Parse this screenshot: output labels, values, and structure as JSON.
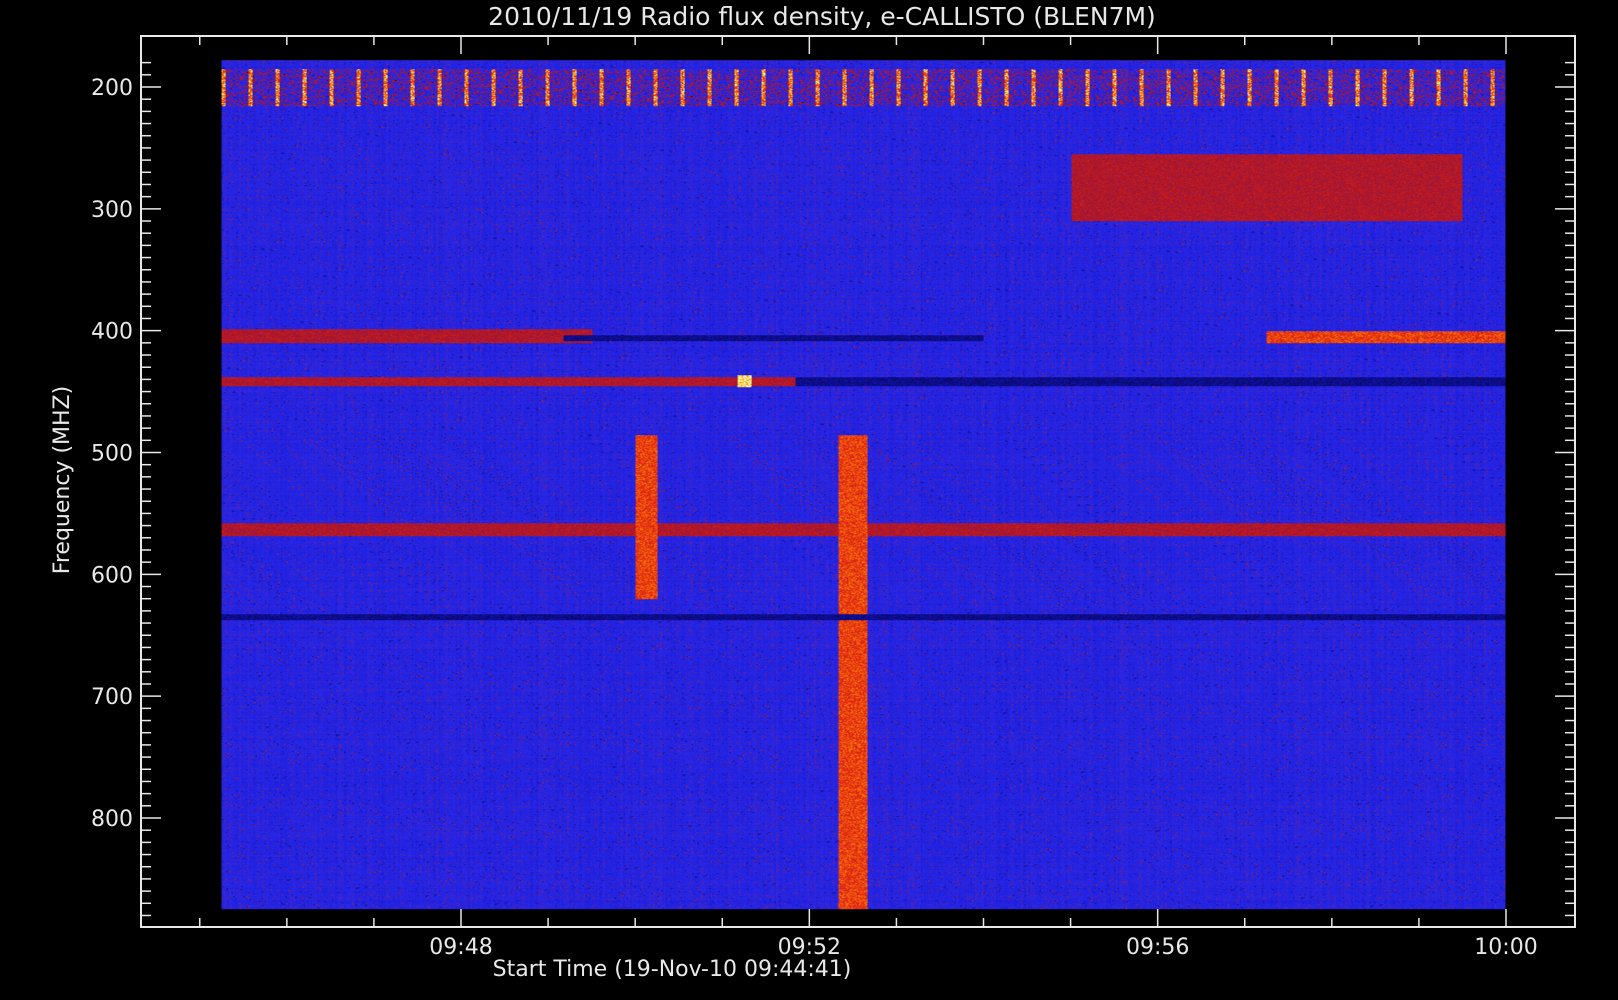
{
  "chart_data": {
    "type": "heatmap",
    "title": "2010/11/19  Radio flux density, e-CALLISTO (BLEN7M)",
    "xlabel": "Start Time (19-Nov-10 09:44:41)",
    "ylabel": "Frequency (MHZ)",
    "x_ticks": [
      "09:48",
      "09:52",
      "09:56",
      "10:00"
    ],
    "y_ticks": [
      "200",
      "300",
      "400",
      "500",
      "600",
      "700",
      "800"
    ],
    "x_range": [
      "09:44:41",
      "10:00:00"
    ],
    "y_range_mhz": [
      180,
      880
    ],
    "y_inverted": true,
    "colormap": [
      "#000000",
      "#1a1ae0",
      "#c0181a",
      "#ff6a00",
      "#ffff66",
      "#ffffff"
    ],
    "background_color": "#000000",
    "data_start_time": "09:45:15",
    "data_end_time": "10:00:00",
    "data_freq_mhz": [
      178,
      875
    ],
    "features": [
      {
        "name": "periodic interference bursts",
        "freq_mhz": [
          185,
          215
        ],
        "time": [
          "09:45:15",
          "10:00:00"
        ],
        "intensity": "high",
        "pattern": "dashed"
      },
      {
        "name": "emission band",
        "freq_mhz": [
          398,
          410
        ],
        "time": [
          "09:45:15",
          "09:49:30"
        ],
        "intensity": "medium"
      },
      {
        "name": "absorption line",
        "freq_mhz": [
          403,
          408
        ],
        "time": [
          "09:49:10",
          "09:54:00"
        ],
        "intensity": "low"
      },
      {
        "name": "strong emission band",
        "freq_mhz": [
          400,
          410
        ],
        "time": [
          "09:57:15",
          "10:00:00"
        ],
        "intensity": "high"
      },
      {
        "name": "emission line",
        "freq_mhz": [
          438,
          445
        ],
        "time": [
          "09:45:15",
          "09:51:50"
        ],
        "intensity": "medium"
      },
      {
        "name": "absorption line",
        "freq_mhz": [
          438,
          445
        ],
        "time": [
          "09:51:50",
          "10:00:00"
        ],
        "intensity": "low"
      },
      {
        "name": "bright spot",
        "freq_mhz": [
          436,
          446
        ],
        "time": [
          "09:51:10",
          "09:51:20"
        ],
        "intensity": "max"
      },
      {
        "name": "vertical burst",
        "freq_mhz": [
          485,
          620
        ],
        "time": [
          "09:50:00",
          "09:50:15"
        ],
        "intensity": "high"
      },
      {
        "name": "vertical burst",
        "freq_mhz": [
          485,
          875
        ],
        "time": [
          "09:52:20",
          "09:52:40"
        ],
        "intensity": "high"
      },
      {
        "name": "mixed line",
        "freq_mhz": [
          558,
          568
        ],
        "time": [
          "09:45:15",
          "10:00:00"
        ],
        "intensity": "medium"
      },
      {
        "name": "faint absorption line",
        "freq_mhz": [
          632,
          637
        ],
        "time": [
          "09:45:15",
          "10:00:00"
        ],
        "intensity": "low"
      },
      {
        "name": "faint emission patches",
        "freq_mhz": [
          255,
          310
        ],
        "time": [
          "09:55:00",
          "09:59:30"
        ],
        "intensity": "medium"
      }
    ]
  }
}
